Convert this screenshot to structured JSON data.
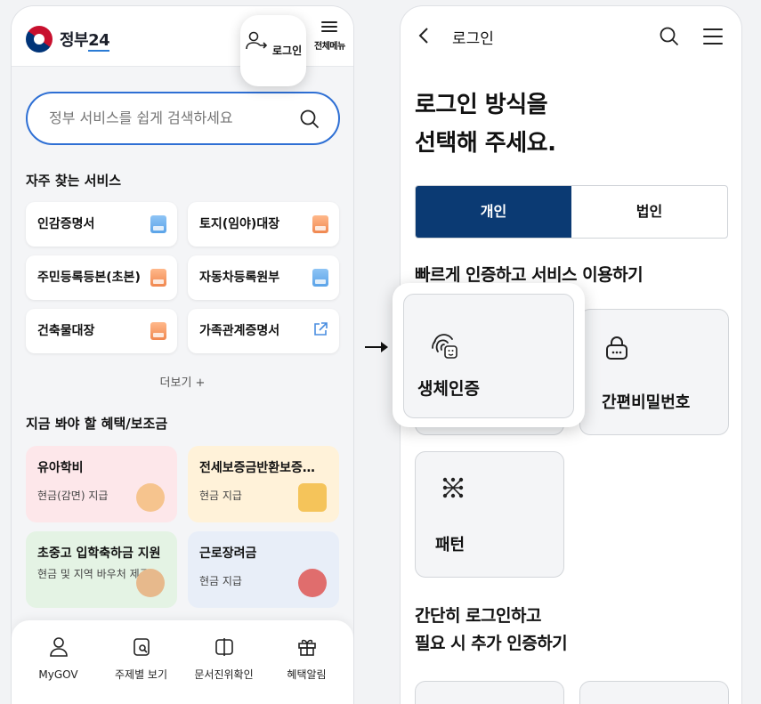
{
  "left": {
    "logo_text_a": "정부",
    "logo_text_b": "24",
    "login_label": "로그인",
    "menu_label": "전체메뉴",
    "search_placeholder": "정부 서비스를 쉽게 검색하세요",
    "freq_title": "자주 찾는 서비스",
    "services": [
      {
        "label": "인감증명서",
        "icon": "document-icon"
      },
      {
        "label": "토지(임야)대장",
        "icon": "document-icon"
      },
      {
        "label": "주민등록등본(초본)",
        "icon": "document-icon"
      },
      {
        "label": "자동차등록원부",
        "icon": "document-icon"
      },
      {
        "label": "건축물대장",
        "icon": "document-icon"
      },
      {
        "label": "가족관계증명서",
        "icon": "external-link-icon"
      }
    ],
    "more_label": "더보기 +",
    "benefit_title": "지금 봐야 할 혜택/보조금",
    "benefits": [
      {
        "title": "유아학비",
        "desc": "현금(감면) 지급",
        "bg": "#fde7ea"
      },
      {
        "title": "전세보증금반환보증…",
        "desc": "현금 지급",
        "bg": "#fff2d9"
      },
      {
        "title": "초중고 입학축하금 지원",
        "desc": "현금 및 지역 바우처 제공",
        "bg": "#e4f3e4"
      },
      {
        "title": "근로장려금",
        "desc": "현금 지급",
        "bg": "#e8eef8"
      }
    ],
    "nav": [
      {
        "label": "MyGOV",
        "icon": "user-icon"
      },
      {
        "label": "주제별 보기",
        "icon": "topic-icon"
      },
      {
        "label": "문서진위확인",
        "icon": "document-verify-icon"
      },
      {
        "label": "혜택알림",
        "icon": "gift-icon"
      }
    ]
  },
  "right": {
    "title": "로그인",
    "headline_1": "로그인 방식을",
    "headline_2": "선택해 주세요.",
    "tab_personal": "개인",
    "tab_corporate": "법인",
    "quick_title": "빠르게 인증하고 서비스 이용하기",
    "bio_label": "생체인증",
    "pin_label": "간편비밀번호",
    "pattern_label": "패턴",
    "simple_title_1": "간단히 로그인하고",
    "simple_title_2": "필요 시 추가 인증하기"
  }
}
